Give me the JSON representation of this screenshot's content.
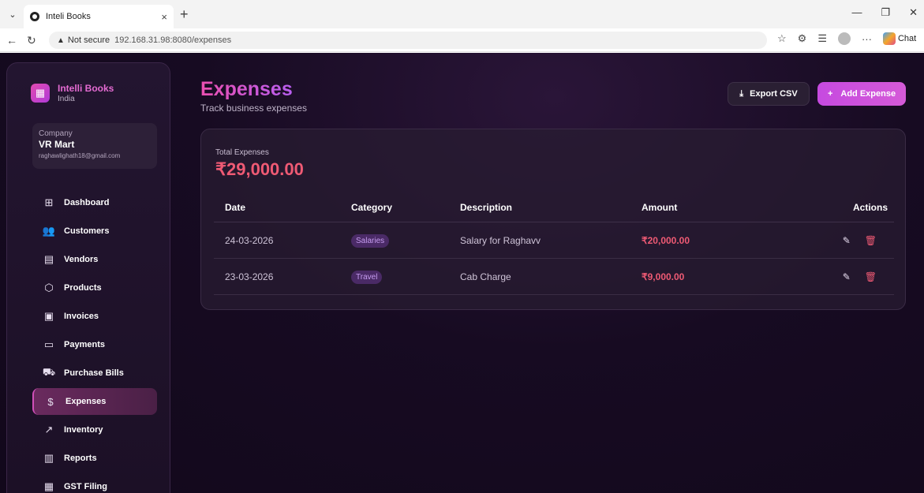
{
  "browser": {
    "tab_title": "Inteli Books",
    "tab_close": "×",
    "new_tab": "+",
    "url_not_secure": "Not secure",
    "url": "192.168.31.98:8080/expenses",
    "copilot_label": "Chat",
    "icons": [
      "tab-menu-icon",
      "back-icon",
      "reload-icon",
      "star-icon",
      "extensions-icon",
      "favorites-icon",
      "profile-icon",
      "more-icon",
      "copilot-icon"
    ]
  },
  "sidebar": {
    "brand_name": "Intelli Books",
    "brand_sub": "India",
    "company_label": "Company",
    "company_name": "VR Mart",
    "company_email": "raghawlighath18@gmail.com",
    "items": [
      {
        "label": "Dashboard",
        "icon": "dashboard-icon"
      },
      {
        "label": "Customers",
        "icon": "customers-icon"
      },
      {
        "label": "Vendors",
        "icon": "vendors-icon"
      },
      {
        "label": "Products",
        "icon": "products-icon"
      },
      {
        "label": "Invoices",
        "icon": "invoices-icon"
      },
      {
        "label": "Payments",
        "icon": "payments-icon"
      },
      {
        "label": "Purchase Bills",
        "icon": "cart-icon"
      },
      {
        "label": "Expenses",
        "icon": "dollar-icon",
        "active": true
      },
      {
        "label": "Inventory",
        "icon": "trend-icon"
      },
      {
        "label": "Reports",
        "icon": "bar-chart-icon"
      },
      {
        "label": "GST Filing",
        "icon": "calculator-icon"
      }
    ]
  },
  "header": {
    "title": "Expenses",
    "subtitle": "Track business expenses",
    "export_label": "Export CSV",
    "add_label": "Add Expense"
  },
  "summary": {
    "total_label": "Total Expenses",
    "total_value": "₹29,000.00"
  },
  "table": {
    "columns": [
      "Date",
      "Category",
      "Description",
      "Amount",
      "Actions"
    ],
    "rows": [
      {
        "date": "24-03-2026",
        "category": "Salaries",
        "description": "Salary for Raghavv",
        "amount": "₹20,000.00"
      },
      {
        "date": "23-03-2026",
        "category": "Travel",
        "description": "Cab Charge",
        "amount": "₹9,000.00"
      }
    ]
  },
  "colors": {
    "accent": "#d04fb8",
    "amount": "#ef5a74",
    "background": "#170b22"
  }
}
